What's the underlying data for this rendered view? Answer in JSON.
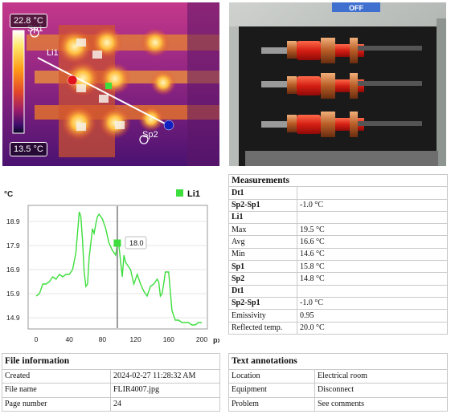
{
  "thermal": {
    "scale_max": "22.8 °C",
    "scale_min": "13.5 °C",
    "markers": {
      "sp1": "Sp1",
      "sp2": "Sp2",
      "li1": "Li1"
    },
    "palette": [
      "#ffffff",
      "#ffe96a",
      "#ff9a18",
      "#e2462a",
      "#9a1c6c",
      "#3e0e6d",
      "#0b0620"
    ]
  },
  "chart": {
    "unit_label": "°C",
    "legend": "Li1",
    "marker_value": "18.0",
    "pixel_unit": "px"
  },
  "chart_data": {
    "type": "line",
    "series": [
      {
        "name": "Li1",
        "color": "#3dde3d"
      }
    ],
    "x_ticks": [
      0,
      40,
      80,
      120,
      160,
      200
    ],
    "y_ticks": [
      14.9,
      15.9,
      16.9,
      17.9,
      18.9
    ],
    "xlim": [
      0,
      200
    ],
    "ylim": [
      14.5,
      19.5
    ],
    "marker": {
      "x": 98,
      "y": 18.0,
      "label": "18.0"
    },
    "x": [
      0,
      4,
      8,
      12,
      16,
      20,
      24,
      28,
      32,
      36,
      40,
      44,
      48,
      52,
      54,
      56,
      58,
      60,
      62,
      64,
      66,
      68,
      70,
      72,
      74,
      76,
      80,
      84,
      88,
      92,
      96,
      98,
      100,
      102,
      104,
      106,
      108,
      110,
      114,
      118,
      122,
      126,
      130,
      134,
      138,
      142,
      146,
      148,
      150,
      152,
      154,
      156,
      158,
      160,
      164,
      168,
      172,
      176,
      180,
      184,
      188,
      192,
      196,
      200
    ],
    "y": [
      15.8,
      15.9,
      16.3,
      16.3,
      16.4,
      16.6,
      16.5,
      16.7,
      16.6,
      16.7,
      16.7,
      16.9,
      17.6,
      19.3,
      19.1,
      18.1,
      16.8,
      16.2,
      16.3,
      17.4,
      18.0,
      18.6,
      18.4,
      18.8,
      19.1,
      19.2,
      19.0,
      18.6,
      18.0,
      17.7,
      17.5,
      18.0,
      17.9,
      17.2,
      16.6,
      17.5,
      17.2,
      17.1,
      16.9,
      16.3,
      16.7,
      16.3,
      16.0,
      15.8,
      16.2,
      16.3,
      16.5,
      16.4,
      15.8,
      15.9,
      16.3,
      16.8,
      16.8,
      16.8,
      15.2,
      14.8,
      14.8,
      14.7,
      14.7,
      14.7,
      14.6,
      14.6,
      14.7,
      14.7
    ]
  },
  "measurements": {
    "title": "Measurements",
    "rows": [
      [
        "Dt1",
        ""
      ],
      [
        "Sp2-Sp1",
        "-1.0 °C"
      ],
      [
        "Li1",
        ""
      ],
      [
        "Max",
        "19.5 °C"
      ],
      [
        "Avg",
        "16.6 °C"
      ],
      [
        "Min",
        "14.6 °C"
      ],
      [
        "Sp1",
        "15.8 °C"
      ],
      [
        "Sp2",
        "14.8 °C"
      ],
      [
        "Dt1",
        ""
      ],
      [
        "Sp2-Sp1",
        "-1.0 °C"
      ],
      [
        "Emissivity",
        "0.95"
      ],
      [
        "Reflected temp.",
        "20.0 °C"
      ]
    ]
  },
  "file_info": {
    "title": "File information",
    "rows": [
      [
        "Created",
        "2024-02-27 11:28:32 AM"
      ],
      [
        "File name",
        "FLIR4007.jpg"
      ],
      [
        "Page number",
        "24"
      ]
    ]
  },
  "text_annotations": {
    "title": "Text annotations",
    "rows": [
      [
        "Location",
        "Electrical room"
      ],
      [
        "Equipment",
        "Disconnect"
      ],
      [
        "Problem",
        "See comments"
      ]
    ]
  },
  "photo": {
    "switch_label": "OFF"
  }
}
